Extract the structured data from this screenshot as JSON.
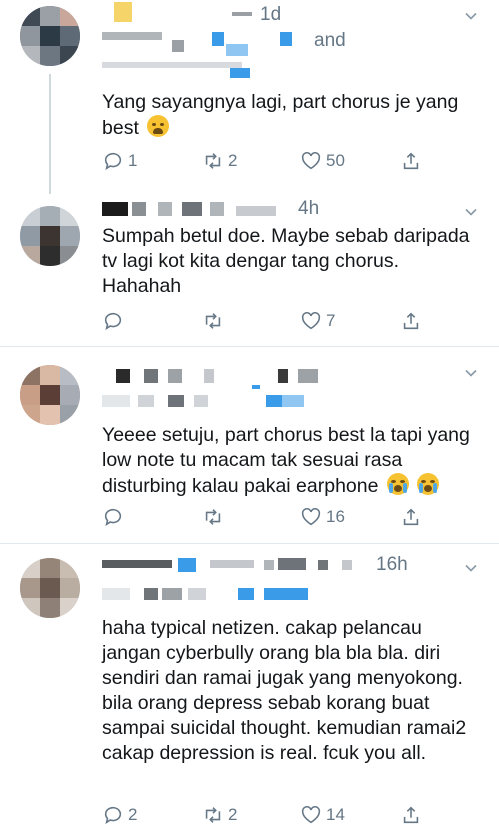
{
  "tweets": [
    {
      "time": "1d",
      "handle_fragment": "and",
      "text": "Yang sayangnya lagi, part chorus je yang best",
      "emoji": "weary-face-emoji",
      "replies": "1",
      "retweets": "2",
      "likes": "50"
    },
    {
      "time": "4h",
      "text": "Sumpah betul doe. Maybe sebab daripada tv lagi kot kita dengar tang chorus. Hahahah",
      "replies": "",
      "retweets": "",
      "likes": "7"
    },
    {
      "time": "",
      "text": "Yeeee setuju, part chorus best la tapi yang low note tu macam tak sesuai rasa disturbing kalau pakai earphone",
      "emoji": "crying-face-emoji",
      "replies": "",
      "retweets": "",
      "likes": "16"
    },
    {
      "time": "16h",
      "text": "haha typical netizen. cakap pelancau jangan cyberbully orang bla bla bla. diri sendiri dan ramai jugak yang menyokong. bila orang depress sebab korang buat sampai suicidal thought. kemudian ramai2 cakap depression is real. fcuk you all.",
      "replies": "2",
      "retweets": "2",
      "likes": "14"
    }
  ],
  "colors": {
    "text": "#14171a",
    "muted": "#657786",
    "divider": "#e1e8ed",
    "redaction_blue": "#3a9be8"
  },
  "icons": [
    "reply-icon",
    "retweet-icon",
    "like-icon",
    "share-icon",
    "chevron-down-icon"
  ]
}
